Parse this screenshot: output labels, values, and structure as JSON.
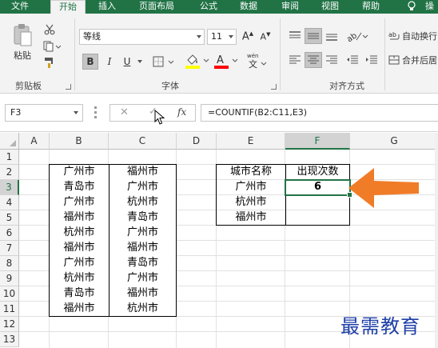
{
  "ribbon_tabs": [
    "文件",
    "开始",
    "插入",
    "页面布局",
    "公式",
    "数据",
    "审阅",
    "视图",
    "帮助"
  ],
  "tab_overflow": "操",
  "clipboard": {
    "paste_label": "粘贴",
    "group_label": "剪贴板"
  },
  "font": {
    "name": "等线",
    "size": "11",
    "bold": "B",
    "italic": "I",
    "underline": "U",
    "group_label": "字体",
    "font_color": "#ff0000",
    "fill_color": "#ffff00"
  },
  "alignment": {
    "wrap_label": "自动换行",
    "merge_label": "合并后居",
    "group_label": "对齐方式"
  },
  "formula_bar": {
    "name_box": "F3",
    "fx": "fx",
    "formula": "=COUNTIF(B2:C11,E3)"
  },
  "columns": [
    "A",
    "B",
    "C",
    "D",
    "E",
    "F",
    "G"
  ],
  "rows": [
    "1",
    "2",
    "3",
    "4",
    "5",
    "6",
    "7",
    "8",
    "9",
    "10",
    "11",
    "12",
    "13"
  ],
  "selected_cell": "F3",
  "table_bc": [
    [
      "广州市",
      "福州市"
    ],
    [
      "青岛市",
      "广州市"
    ],
    [
      "广州市",
      "杭州市"
    ],
    [
      "福州市",
      "青岛市"
    ],
    [
      "杭州市",
      "广州市"
    ],
    [
      "福州市",
      "福州市"
    ],
    [
      "广州市",
      "青岛市"
    ],
    [
      "杭州市",
      "广州市"
    ],
    [
      "青岛市",
      "福州市"
    ],
    [
      "福州市",
      "杭州市"
    ]
  ],
  "table_ef": {
    "header_e": "城市名称",
    "header_f": "出现次数",
    "rows": [
      [
        "广州市",
        "6"
      ],
      [
        "杭州市",
        ""
      ],
      [
        "福州市",
        ""
      ]
    ]
  },
  "annotation": {
    "arrow_color": "#f07c28",
    "icon": "arrow-left-icon"
  },
  "watermark": "最需教育",
  "accent_color": "#217346"
}
